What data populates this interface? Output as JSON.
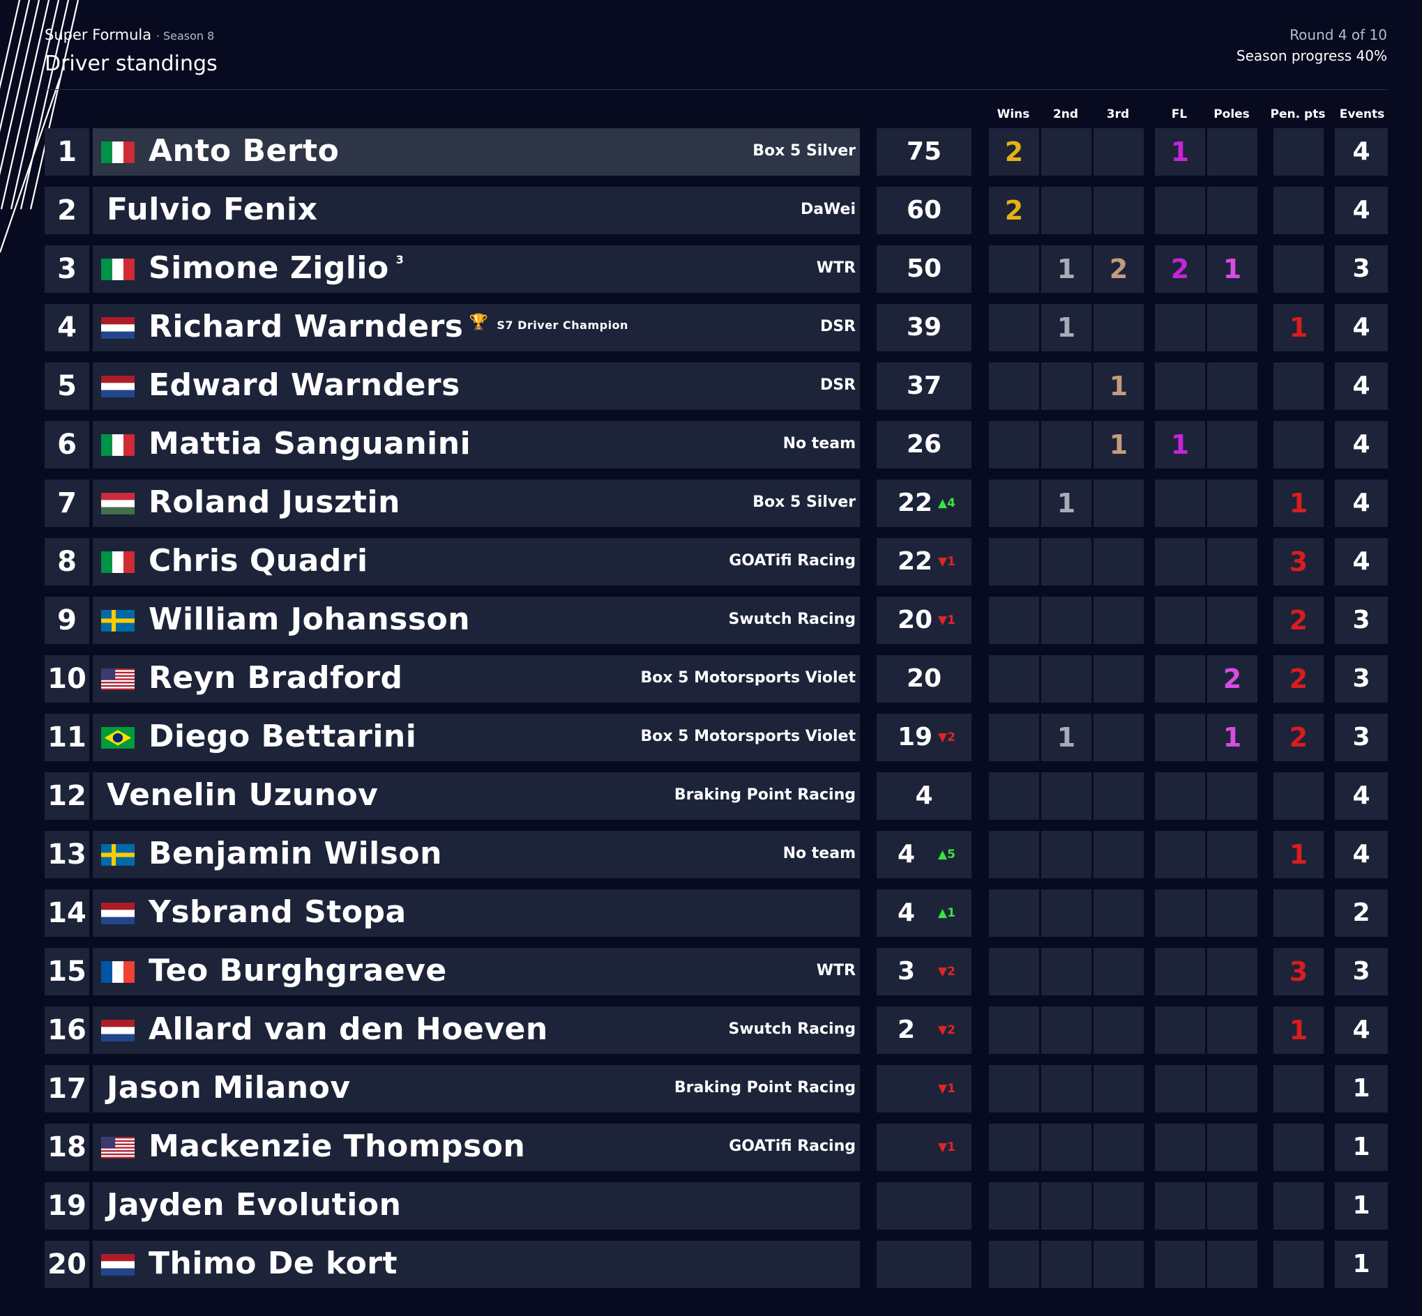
{
  "header": {
    "series": "Super Formula",
    "season": "· Season 8",
    "page_title": "Driver standings",
    "round": "Round 4 of 10",
    "progress": "Season progress 40%"
  },
  "columns": [
    "Wins",
    "2nd",
    "3rd",
    "FL",
    "Poles",
    "Pen. pts",
    "Events"
  ],
  "colors": {
    "gold": "#e5b212",
    "silver": "#a8acb8",
    "bronze": "#c39b7e",
    "fastest_lap": "#c624d8",
    "pole": "#d84ce0",
    "penalty": "#d91d1d",
    "up": "#39e33f",
    "down": "#e02525",
    "background": "#080b1f",
    "cell": "#1d2439"
  },
  "drivers": [
    {
      "pos": "1",
      "flag": "it",
      "name": "Anto Berto",
      "team": "Box 5 Silver",
      "pts": "75",
      "change": "",
      "dir": "",
      "wins": "2",
      "p2": "",
      "p3": "",
      "fl": "1",
      "poles": "",
      "pen": "",
      "events": "4",
      "note": "",
      "champ": ""
    },
    {
      "pos": "2",
      "flag": "",
      "name": "Fulvio Fenix",
      "team": "DaWei",
      "pts": "60",
      "change": "",
      "dir": "",
      "wins": "2",
      "p2": "",
      "p3": "",
      "fl": "",
      "poles": "",
      "pen": "",
      "events": "4",
      "note": "",
      "champ": ""
    },
    {
      "pos": "3",
      "flag": "it",
      "name": "Simone Ziglio",
      "team": "WTR",
      "pts": "50",
      "change": "",
      "dir": "",
      "wins": "",
      "p2": "1",
      "p3": "2",
      "fl": "2",
      "poles": "1",
      "pen": "",
      "events": "3",
      "note": "3",
      "champ": ""
    },
    {
      "pos": "4",
      "flag": "nl",
      "name": "Richard Warnders",
      "team": "DSR",
      "pts": "39",
      "change": "",
      "dir": "",
      "wins": "",
      "p2": "1",
      "p3": "",
      "fl": "",
      "poles": "",
      "pen": "1",
      "events": "4",
      "note": "",
      "champ": "S7 Driver Champion"
    },
    {
      "pos": "5",
      "flag": "nl",
      "name": "Edward Warnders",
      "team": "DSR",
      "pts": "37",
      "change": "",
      "dir": "",
      "wins": "",
      "p2": "",
      "p3": "1",
      "fl": "",
      "poles": "",
      "pen": "",
      "events": "4",
      "note": "",
      "champ": ""
    },
    {
      "pos": "6",
      "flag": "it",
      "name": "Mattia Sanguanini",
      "team": "No team",
      "pts": "26",
      "change": "",
      "dir": "",
      "wins": "",
      "p2": "",
      "p3": "1",
      "fl": "1",
      "poles": "",
      "pen": "",
      "events": "4",
      "note": "",
      "champ": ""
    },
    {
      "pos": "7",
      "flag": "hu",
      "name": "Roland Jusztin",
      "team": "Box 5 Silver",
      "pts": "22",
      "change": "▲4",
      "dir": "up",
      "wins": "",
      "p2": "1",
      "p3": "",
      "fl": "",
      "poles": "",
      "pen": "1",
      "events": "4",
      "note": "",
      "champ": ""
    },
    {
      "pos": "8",
      "flag": "it",
      "name": "Chris Quadri",
      "team": "GOATifi Racing",
      "pts": "22",
      "change": "▼1",
      "dir": "dn",
      "wins": "",
      "p2": "",
      "p3": "",
      "fl": "",
      "poles": "",
      "pen": "3",
      "events": "4",
      "note": "",
      "champ": ""
    },
    {
      "pos": "9",
      "flag": "se",
      "name": "William Johansson",
      "team": "Swutch Racing",
      "pts": "20",
      "change": "▼1",
      "dir": "dn",
      "wins": "",
      "p2": "",
      "p3": "",
      "fl": "",
      "poles": "",
      "pen": "2",
      "events": "3",
      "note": "",
      "champ": ""
    },
    {
      "pos": "10",
      "flag": "us",
      "name": "Reyn Bradford",
      "team": "Box 5 Motorsports Violet",
      "pts": "20",
      "change": "",
      "dir": "",
      "wins": "",
      "p2": "",
      "p3": "",
      "fl": "",
      "poles": "2",
      "pen": "2",
      "events": "3",
      "note": "",
      "champ": ""
    },
    {
      "pos": "11",
      "flag": "br",
      "name": "Diego Bettarini",
      "team": "Box 5 Motorsports Violet",
      "pts": "19",
      "change": "▼2",
      "dir": "dn",
      "wins": "",
      "p2": "1",
      "p3": "",
      "fl": "",
      "poles": "1",
      "pen": "2",
      "events": "3",
      "note": "",
      "champ": ""
    },
    {
      "pos": "12",
      "flag": "",
      "name": "Venelin Uzunov",
      "team": "Braking Point Racing",
      "pts": "4",
      "change": "",
      "dir": "",
      "wins": "",
      "p2": "",
      "p3": "",
      "fl": "",
      "poles": "",
      "pen": "",
      "events": "4",
      "note": "",
      "champ": ""
    },
    {
      "pos": "13",
      "flag": "se",
      "name": "Benjamin Wilson",
      "team": "No team",
      "pts": "4",
      "change": "▲5",
      "dir": "up",
      "wins": "",
      "p2": "",
      "p3": "",
      "fl": "",
      "poles": "",
      "pen": "1",
      "events": "4",
      "note": "",
      "champ": ""
    },
    {
      "pos": "14",
      "flag": "nl",
      "name": "Ysbrand Stopa",
      "team": "",
      "pts": "4",
      "change": "▲1",
      "dir": "up",
      "wins": "",
      "p2": "",
      "p3": "",
      "fl": "",
      "poles": "",
      "pen": "",
      "events": "2",
      "note": "",
      "champ": ""
    },
    {
      "pos": "15",
      "flag": "fr",
      "name": "Teo Burghgraeve",
      "team": "WTR",
      "pts": "3",
      "change": "▼2",
      "dir": "dn",
      "wins": "",
      "p2": "",
      "p3": "",
      "fl": "",
      "poles": "",
      "pen": "3",
      "events": "3",
      "note": "",
      "champ": ""
    },
    {
      "pos": "16",
      "flag": "nl",
      "name": "Allard van den Hoeven",
      "team": "Swutch Racing",
      "pts": "2",
      "change": "▼2",
      "dir": "dn",
      "wins": "",
      "p2": "",
      "p3": "",
      "fl": "",
      "poles": "",
      "pen": "1",
      "events": "4",
      "note": "",
      "champ": ""
    },
    {
      "pos": "17",
      "flag": "",
      "name": "Jason Milanov",
      "team": "Braking Point Racing",
      "pts": "",
      "change": "▼1",
      "dir": "dn",
      "wins": "",
      "p2": "",
      "p3": "",
      "fl": "",
      "poles": "",
      "pen": "",
      "events": "1",
      "note": "",
      "champ": ""
    },
    {
      "pos": "18",
      "flag": "us",
      "name": "Mackenzie Thompson",
      "team": "GOATifi Racing",
      "pts": "",
      "change": "▼1",
      "dir": "dn",
      "wins": "",
      "p2": "",
      "p3": "",
      "fl": "",
      "poles": "",
      "pen": "",
      "events": "1",
      "note": "",
      "champ": ""
    },
    {
      "pos": "19",
      "flag": "",
      "name": "Jayden Evolution",
      "team": "",
      "pts": "",
      "change": "",
      "dir": "",
      "wins": "",
      "p2": "",
      "p3": "",
      "fl": "",
      "poles": "",
      "pen": "",
      "events": "1",
      "note": "",
      "champ": ""
    },
    {
      "pos": "20",
      "flag": "nl",
      "name": "Thimo De kort",
      "team": "",
      "pts": "",
      "change": "",
      "dir": "",
      "wins": "",
      "p2": "",
      "p3": "",
      "fl": "",
      "poles": "",
      "pen": "",
      "events": "1",
      "note": "",
      "champ": ""
    }
  ]
}
